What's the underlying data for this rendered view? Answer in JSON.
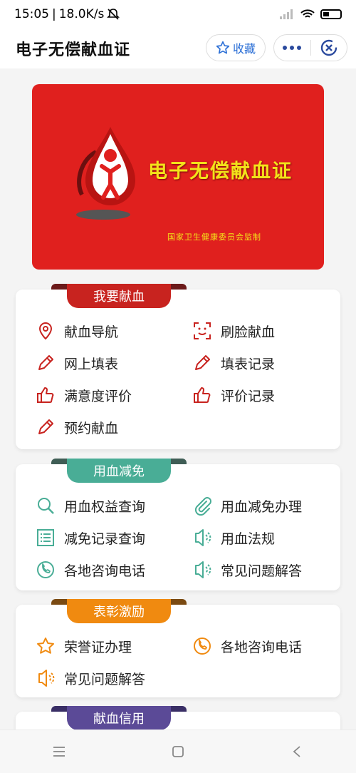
{
  "status": {
    "time": "15:05",
    "speed": "18.0K/s"
  },
  "header": {
    "title": "电子无偿献血证",
    "fav_label": "收藏"
  },
  "banner": {
    "title": "电子无偿献血证",
    "subtitle": "国家卫生健康委员会监制"
  },
  "sections": [
    {
      "title": "我要献血",
      "color": "#c8231f",
      "items": [
        "献血导航",
        "刷脸献血",
        "网上填表",
        "填表记录",
        "满意度评价",
        "评价记录",
        "预约献血"
      ]
    },
    {
      "title": "用血减免",
      "color": "#49ad96",
      "items": [
        "用血权益查询",
        "用血减免办理",
        "减免记录查询",
        "用血法规",
        "各地咨询电话",
        "常见问题解答"
      ]
    },
    {
      "title": "表彰激励",
      "color": "#f08a10",
      "items": [
        "荣誉证办理",
        "各地咨询电话",
        "常见问题解答"
      ]
    },
    {
      "title": "献血信用",
      "color": "#5b4a97",
      "items": []
    }
  ]
}
